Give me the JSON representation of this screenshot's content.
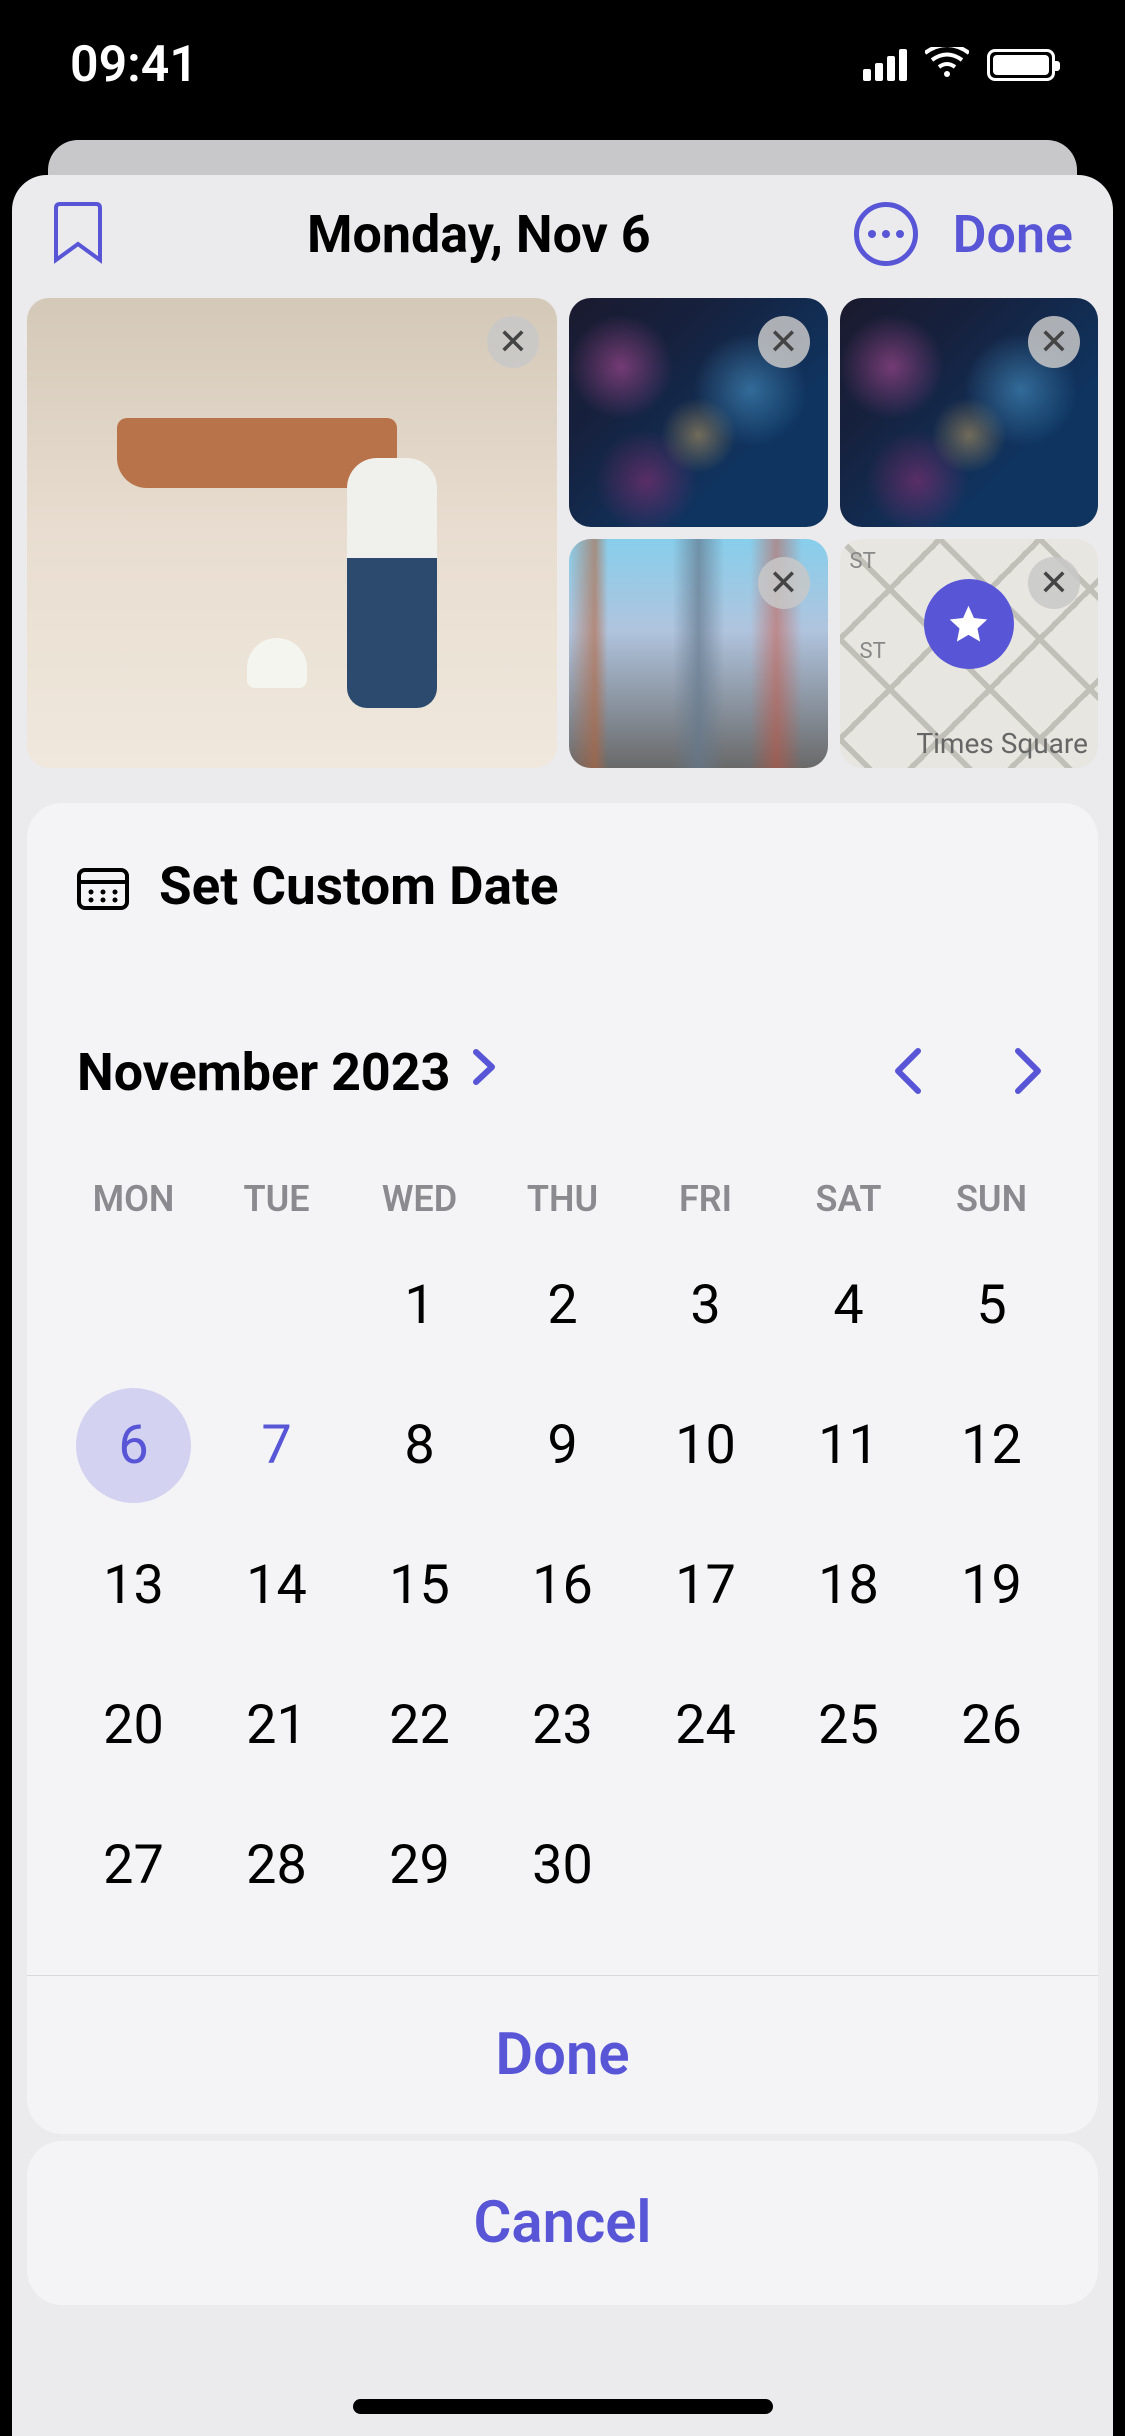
{
  "statusBar": {
    "time": "09:41"
  },
  "header": {
    "title": "Monday, Nov 6",
    "doneLabel": "Done"
  },
  "photos": {
    "mapLabel": "Times Square",
    "stLabel1": "ST",
    "stLabel2": "ST"
  },
  "dateSheet": {
    "title": "Set Custom Date",
    "monthYear": "November 2023",
    "weekdays": [
      "MON",
      "TUE",
      "WED",
      "THU",
      "FRI",
      "SAT",
      "SUN"
    ],
    "selectedDay": 6,
    "todayDay": 7,
    "weeks": [
      [
        "",
        "",
        "1",
        "2",
        "3",
        "4",
        "5"
      ],
      [
        "6",
        "7",
        "8",
        "9",
        "10",
        "11",
        "12"
      ],
      [
        "13",
        "14",
        "15",
        "16",
        "17",
        "18",
        "19"
      ],
      [
        "20",
        "21",
        "22",
        "23",
        "24",
        "25",
        "26"
      ],
      [
        "27",
        "28",
        "29",
        "30",
        "",
        "",
        ""
      ]
    ],
    "doneLabel": "Done"
  },
  "cancelLabel": "Cancel"
}
